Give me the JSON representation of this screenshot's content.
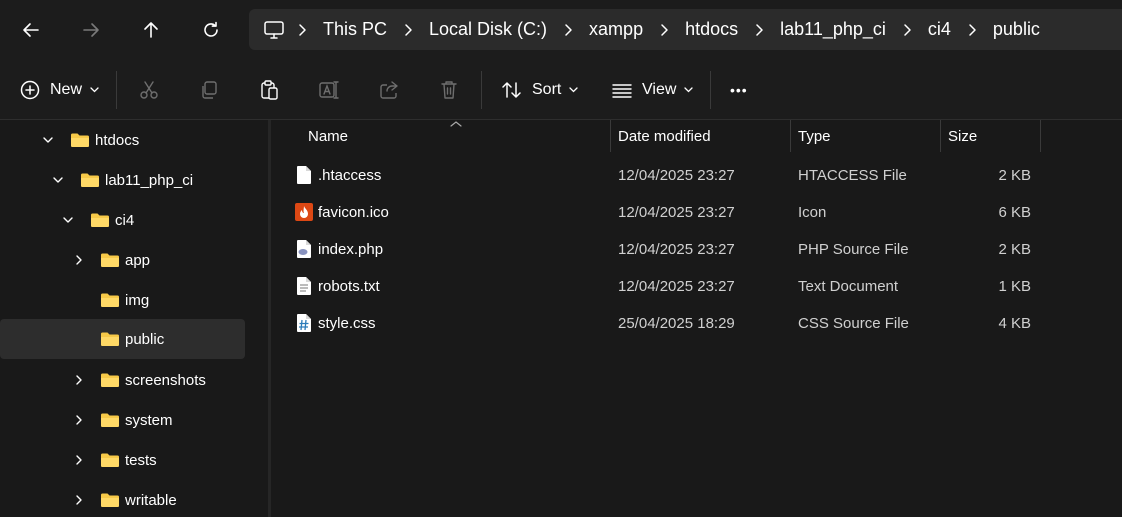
{
  "nav": {
    "back_icon": "arrow-left-icon",
    "forward_icon": "arrow-right-icon",
    "up_icon": "arrow-up-icon",
    "refresh_icon": "refresh-icon"
  },
  "breadcrumb": {
    "root_icon": "computer-icon",
    "items": [
      "This PC",
      "Local Disk (C:)",
      "xampp",
      "htdocs",
      "lab11_php_ci",
      "ci4",
      "public"
    ]
  },
  "toolbar": {
    "new_label": "New",
    "sort_label": "Sort",
    "view_label": "View",
    "more_label": "•••"
  },
  "sidebar": {
    "items": [
      {
        "label": "htdocs",
        "expanded": true
      },
      {
        "label": "lab11_php_ci",
        "expanded": true
      },
      {
        "label": "ci4",
        "expanded": true
      },
      {
        "label": "app",
        "expanded": false
      },
      {
        "label": "img"
      },
      {
        "label": "public",
        "selected": true
      },
      {
        "label": "screenshots",
        "expanded": false
      },
      {
        "label": "system",
        "expanded": false
      },
      {
        "label": "tests",
        "expanded": false
      },
      {
        "label": "writable",
        "expanded": false
      }
    ]
  },
  "columns": {
    "name": "Name",
    "date": "Date modified",
    "type": "Type",
    "size": "Size"
  },
  "files": [
    {
      "name": ".htaccess",
      "date": "12/04/2025 23:27",
      "type": "HTACCESS File",
      "size": "2 KB",
      "icon": "blank-file-icon"
    },
    {
      "name": "favicon.ico",
      "date": "12/04/2025 23:27",
      "type": "Icon",
      "size": "6 KB",
      "icon": "flame-icon"
    },
    {
      "name": "index.php",
      "date": "12/04/2025 23:27",
      "type": "PHP Source File",
      "size": "2 KB",
      "icon": "php-file-icon"
    },
    {
      "name": "robots.txt",
      "date": "12/04/2025 23:27",
      "type": "Text Document",
      "size": "1 KB",
      "icon": "text-file-icon"
    },
    {
      "name": "style.css",
      "date": "25/04/2025 18:29",
      "type": "CSS Source File",
      "size": "4 KB",
      "icon": "css-file-icon"
    }
  ],
  "colors": {
    "background": "#191919",
    "bar": "#1c1c1c",
    "address": "#2b2b2b",
    "folder": "#f7c948",
    "selected": "#2d2d2d"
  }
}
